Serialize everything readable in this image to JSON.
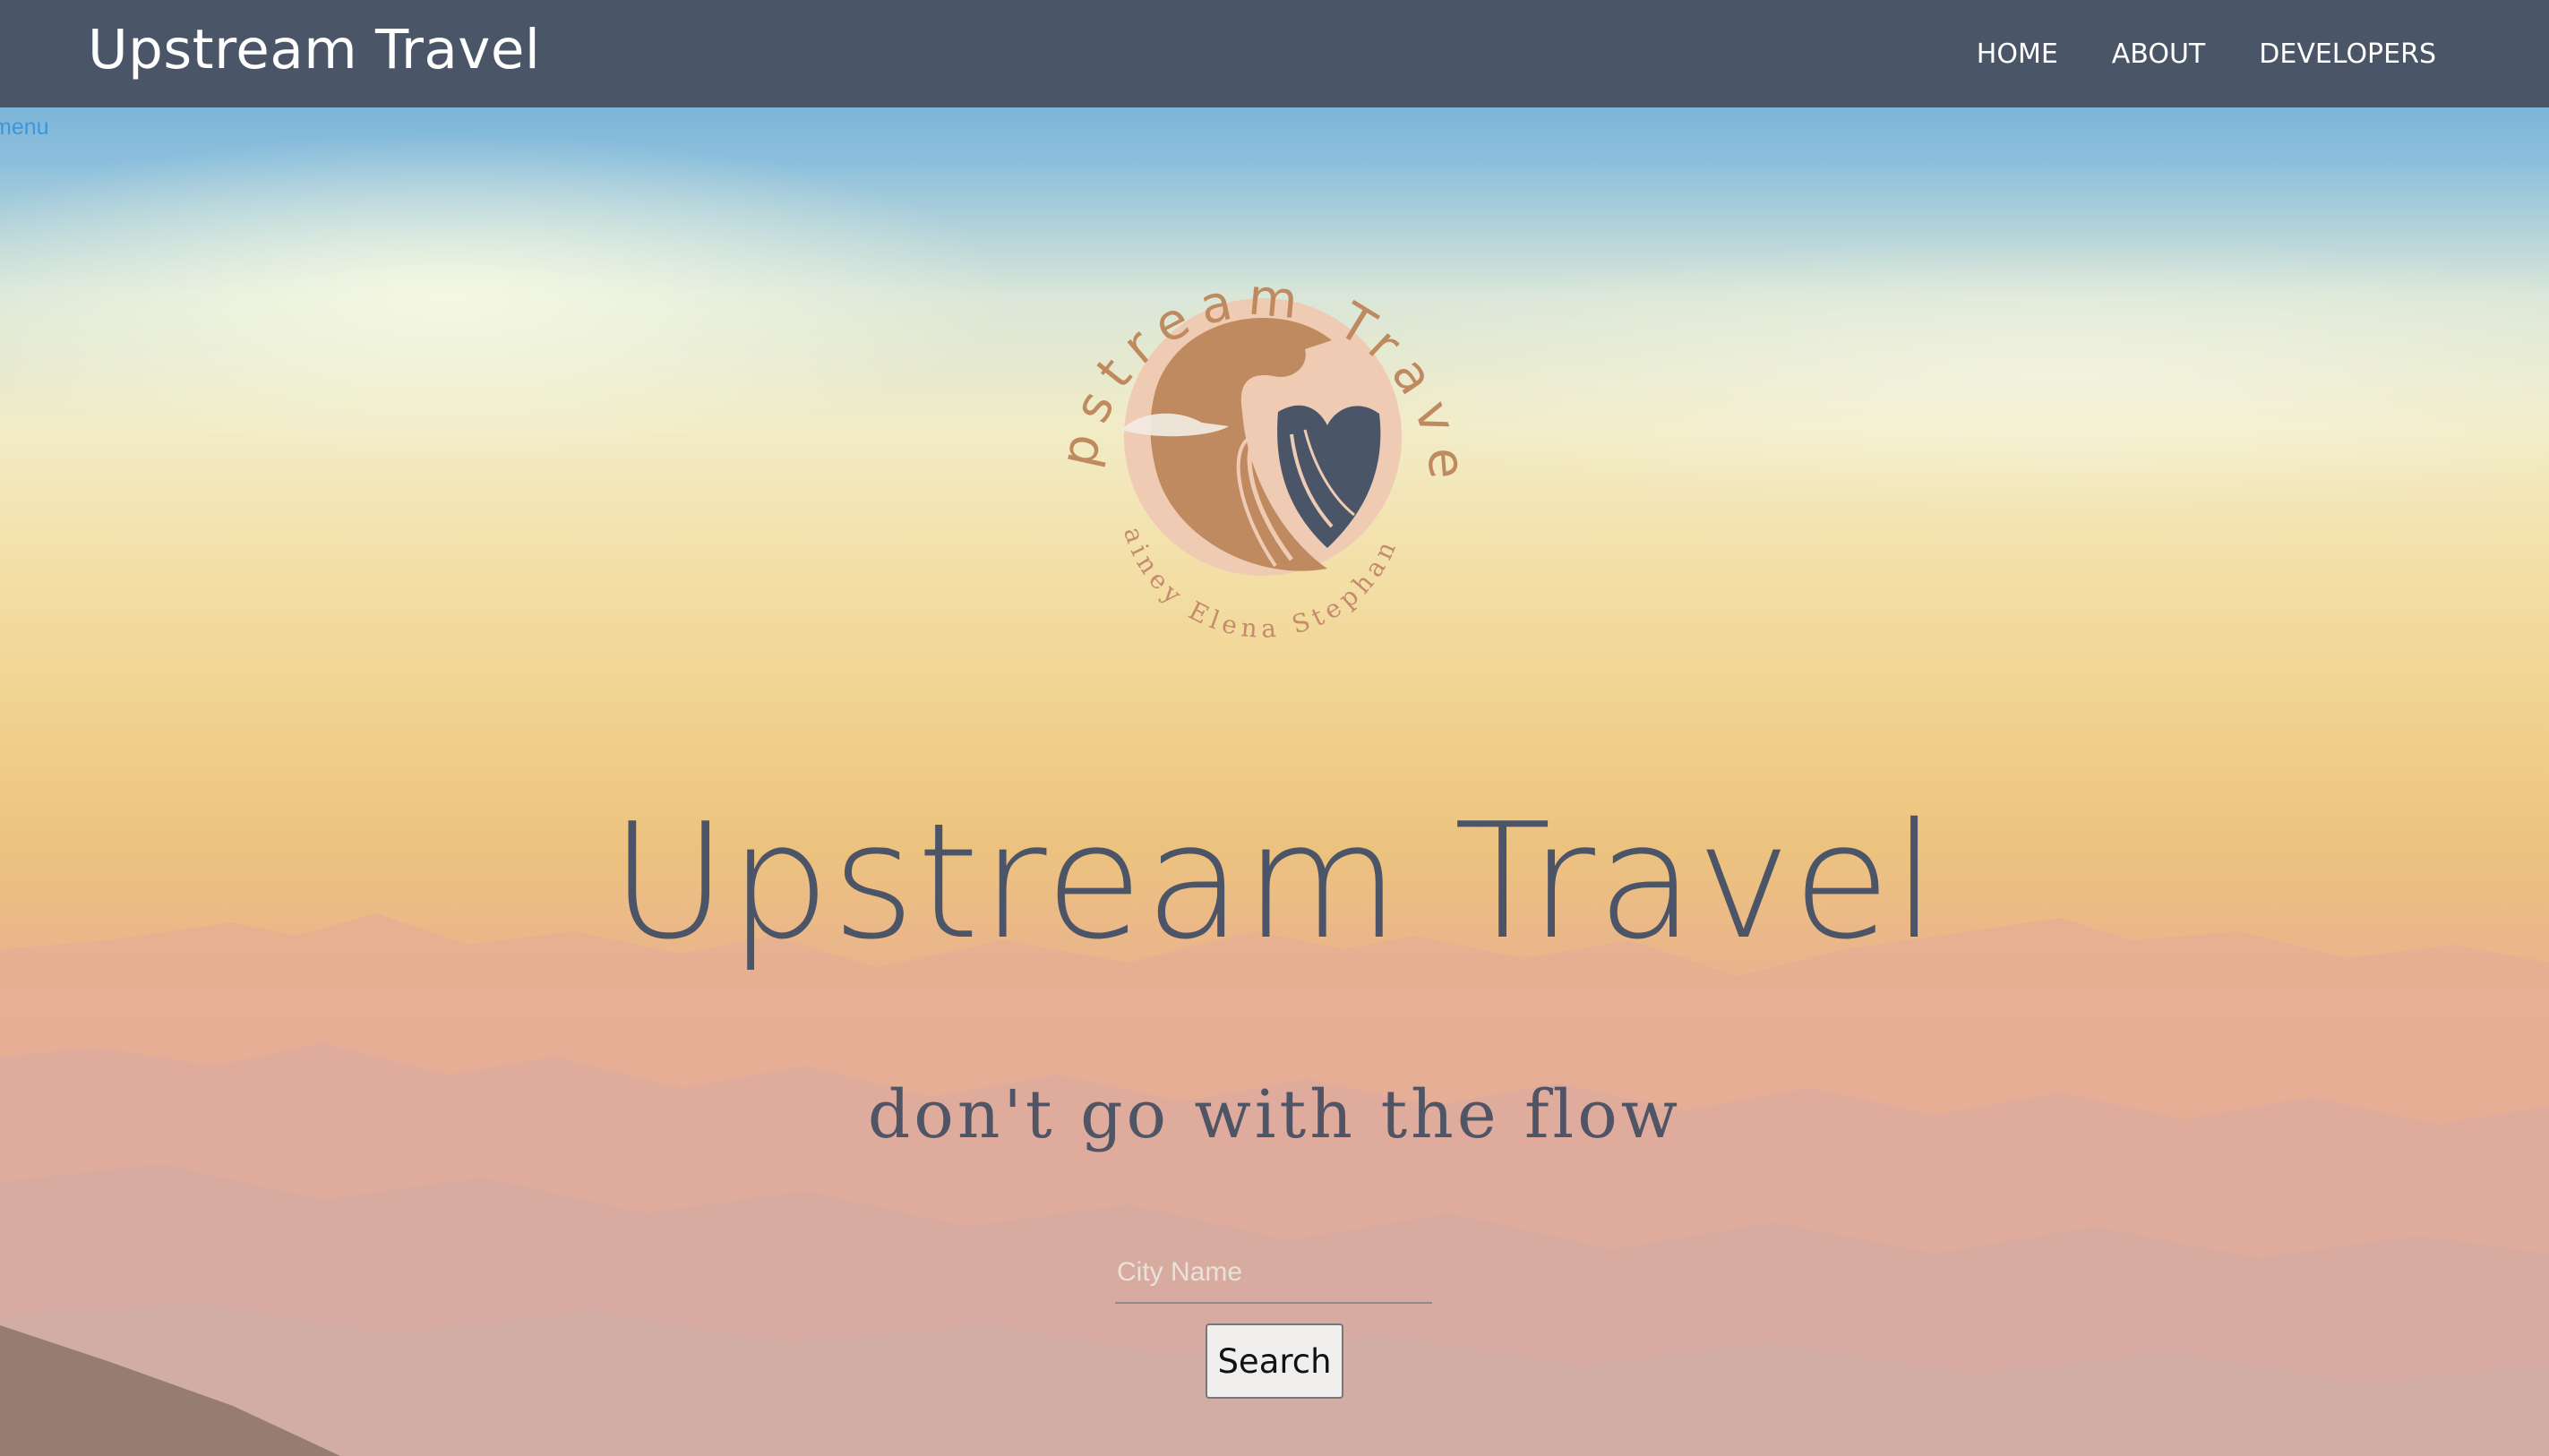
{
  "navbar": {
    "brand": "Upstream Travel",
    "links": [
      "HOME",
      "ABOUT",
      "DEVELOPERS"
    ]
  },
  "menu_link": "menu",
  "logo": {
    "arc_text": "Upstream Travel",
    "names_text": "Lainey Elena Stephanie"
  },
  "hero": {
    "title": "Upstream Travel",
    "tagline": "don't go with the flow"
  },
  "search": {
    "placeholder": "City Name",
    "button_label": "Search"
  },
  "colors": {
    "navbar": "#4a5667",
    "logo_tan": "#bf8a5f",
    "logo_slate": "#4a5667",
    "logo_peach": "#efcbb4",
    "menu_link": "#3d96d9"
  }
}
